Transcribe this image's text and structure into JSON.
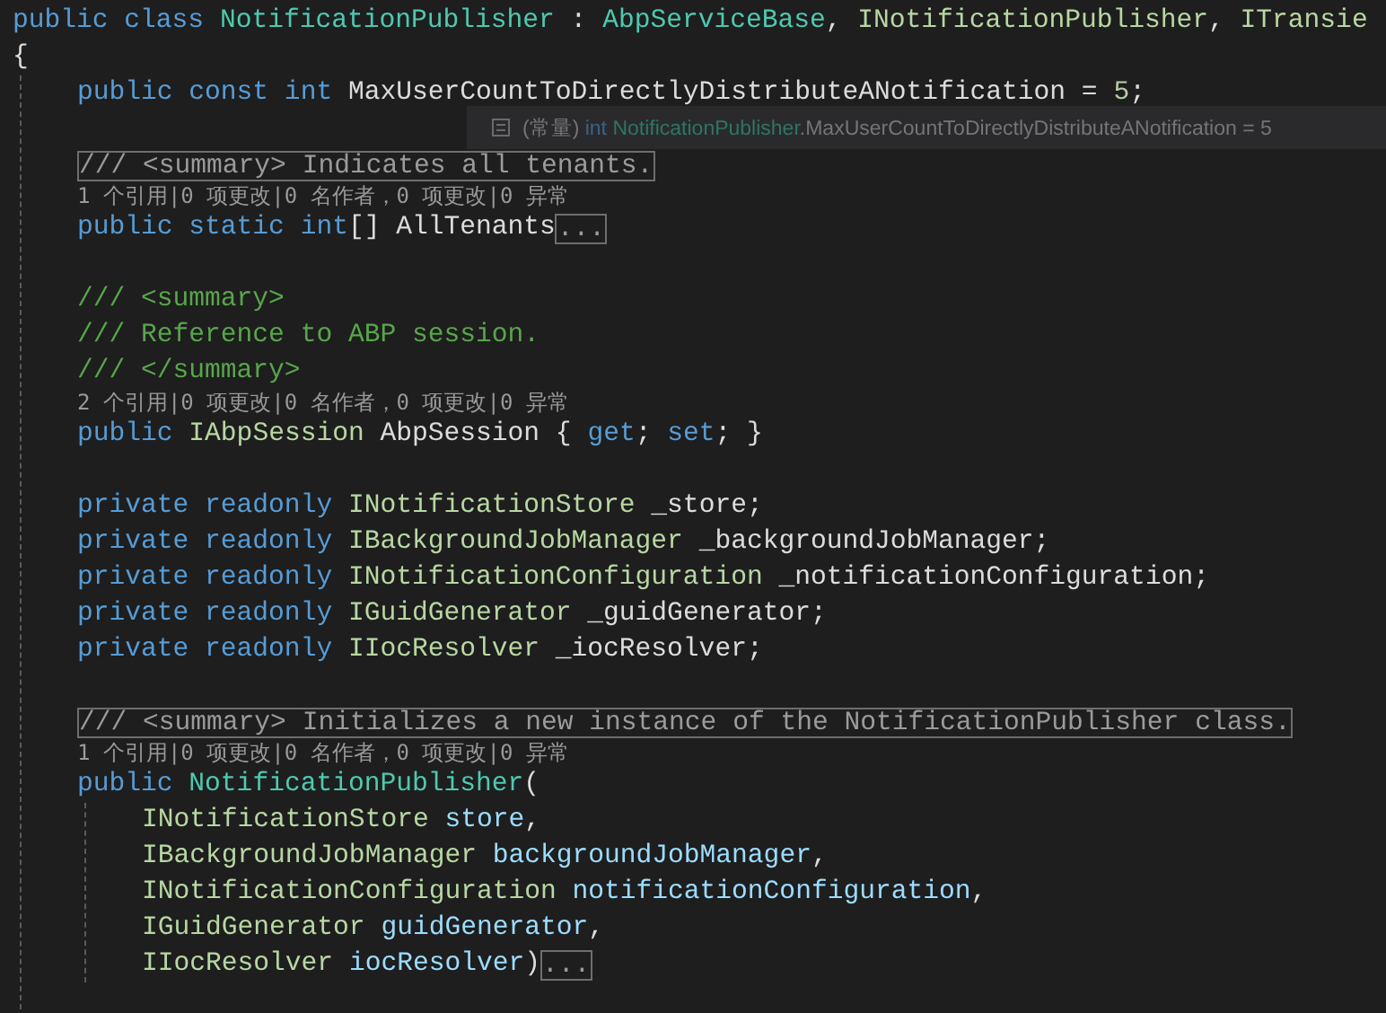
{
  "editor": {
    "lines": [
      {
        "kind": "code",
        "tokens": [
          {
            "text": "public class ",
            "kind": "keyword"
          },
          {
            "text": "NotificationPublisher",
            "kind": "class"
          },
          {
            "text": " : ",
            "kind": "plain"
          },
          {
            "text": "AbpServiceBase",
            "kind": "class"
          },
          {
            "text": ", ",
            "kind": "plain"
          },
          {
            "text": "INotificationPublisher",
            "kind": "interface"
          },
          {
            "text": ", ",
            "kind": "plain"
          },
          {
            "text": "ITransie",
            "kind": "interface"
          }
        ]
      },
      {
        "kind": "code",
        "tokens": [
          {
            "text": "{",
            "kind": "plain"
          }
        ]
      },
      {
        "kind": "block",
        "children": [
          {
            "kind": "code",
            "tokens": [
              {
                "text": "public const int ",
                "kind": "keyword"
              },
              {
                "text": "MaxUserCountToDirectlyDistributeANotification = ",
                "kind": "plain"
              },
              {
                "text": "5",
                "kind": "number"
              },
              {
                "text": ";",
                "kind": "plain"
              }
            ]
          },
          {
            "kind": "blank"
          },
          {
            "kind": "code",
            "tokens": [
              {
                "text": "/// <summary> Indicates all tenants.",
                "kind": "collapsed"
              }
            ]
          },
          {
            "kind": "lens",
            "text": "1 个引用|0 项更改|0 名作者，0 项更改|0 异常"
          },
          {
            "kind": "code",
            "tokens": [
              {
                "text": "public static int",
                "kind": "keyword"
              },
              {
                "text": "[] AllTenants",
                "kind": "plain"
              },
              {
                "text": "...",
                "kind": "collapsed"
              }
            ]
          },
          {
            "kind": "blank"
          },
          {
            "kind": "code",
            "tokens": [
              {
                "text": "/// <summary>",
                "kind": "comment"
              }
            ]
          },
          {
            "kind": "code",
            "tokens": [
              {
                "text": "/// Reference to ABP session.",
                "kind": "comment"
              }
            ]
          },
          {
            "kind": "code",
            "tokens": [
              {
                "text": "/// </summary>",
                "kind": "comment"
              }
            ]
          },
          {
            "kind": "lens",
            "text": "2 个引用|0 项更改|0 名作者，0 项更改|0 异常"
          },
          {
            "kind": "code",
            "tokens": [
              {
                "text": "public ",
                "kind": "keyword"
              },
              {
                "text": "IAbpSession",
                "kind": "interface"
              },
              {
                "text": " AbpSession { ",
                "kind": "plain"
              },
              {
                "text": "get",
                "kind": "keyword"
              },
              {
                "text": "; ",
                "kind": "plain"
              },
              {
                "text": "set",
                "kind": "keyword"
              },
              {
                "text": "; }",
                "kind": "plain"
              }
            ]
          },
          {
            "kind": "blank"
          },
          {
            "kind": "code",
            "tokens": [
              {
                "text": "private readonly ",
                "kind": "keyword"
              },
              {
                "text": "INotificationStore",
                "kind": "interface"
              },
              {
                "text": " _store;",
                "kind": "plain"
              }
            ]
          },
          {
            "kind": "code",
            "tokens": [
              {
                "text": "private readonly ",
                "kind": "keyword"
              },
              {
                "text": "IBackgroundJobManager",
                "kind": "interface"
              },
              {
                "text": " _backgroundJobManager;",
                "kind": "plain"
              }
            ]
          },
          {
            "kind": "code",
            "tokens": [
              {
                "text": "private readonly ",
                "kind": "keyword"
              },
              {
                "text": "INotificationConfiguration",
                "kind": "interface"
              },
              {
                "text": " _notificationConfiguration;",
                "kind": "plain"
              }
            ]
          },
          {
            "kind": "code",
            "tokens": [
              {
                "text": "private readonly ",
                "kind": "keyword"
              },
              {
                "text": "IGuidGenerator",
                "kind": "interface"
              },
              {
                "text": " _guidGenerator;",
                "kind": "plain"
              }
            ]
          },
          {
            "kind": "code",
            "tokens": [
              {
                "text": "private readonly ",
                "kind": "keyword"
              },
              {
                "text": "IIocResolver",
                "kind": "interface"
              },
              {
                "text": " _iocResolver;",
                "kind": "plain"
              }
            ]
          },
          {
            "kind": "blank"
          },
          {
            "kind": "code",
            "tokens": [
              {
                "text": "/// <summary> Initializes a new instance of the NotificationPublisher class.",
                "kind": "collapsed"
              }
            ]
          },
          {
            "kind": "lens",
            "text": "1 个引用|0 项更改|0 名作者，0 项更改|0 异常"
          },
          {
            "kind": "code",
            "tokens": [
              {
                "text": "public ",
                "kind": "keyword"
              },
              {
                "text": "NotificationPublisher",
                "kind": "class"
              },
              {
                "text": "(",
                "kind": "plain"
              }
            ]
          },
          {
            "kind": "block",
            "children": [
              {
                "kind": "code",
                "tokens": [
                  {
                    "text": "INotificationStore ",
                    "kind": "interface"
                  },
                  {
                    "text": "store",
                    "kind": "param"
                  },
                  {
                    "text": ",",
                    "kind": "plain"
                  }
                ]
              },
              {
                "kind": "code",
                "tokens": [
                  {
                    "text": "IBackgroundJobManager ",
                    "kind": "interface"
                  },
                  {
                    "text": "backgroundJobManager",
                    "kind": "param"
                  },
                  {
                    "text": ",",
                    "kind": "plain"
                  }
                ]
              },
              {
                "kind": "code",
                "tokens": [
                  {
                    "text": "INotificationConfiguration ",
                    "kind": "interface"
                  },
                  {
                    "text": "notificationConfiguration",
                    "kind": "param"
                  },
                  {
                    "text": ",",
                    "kind": "plain"
                  }
                ]
              },
              {
                "kind": "code",
                "tokens": [
                  {
                    "text": "IGuidGenerator ",
                    "kind": "interface"
                  },
                  {
                    "text": "guidGenerator",
                    "kind": "param"
                  },
                  {
                    "text": ",",
                    "kind": "plain"
                  }
                ]
              },
              {
                "kind": "code",
                "tokens": [
                  {
                    "text": "IIocResolver ",
                    "kind": "interface"
                  },
                  {
                    "text": "iocResolver",
                    "kind": "param"
                  },
                  {
                    "text": ")",
                    "kind": "plain"
                  },
                  {
                    "text": "...",
                    "kind": "collapsed"
                  }
                ]
              }
            ]
          },
          {
            "kind": "blank"
          }
        ]
      }
    ]
  },
  "quick_info": {
    "tokens": [
      {
        "text": "(常量) ",
        "kind": "plain"
      },
      {
        "text": "int ",
        "kind": "keyword"
      },
      {
        "text": "NotificationPublisher",
        "kind": "class"
      },
      {
        "text": ".MaxUserCountToDirectlyDistributeANotification = 5",
        "kind": "plain"
      }
    ]
  }
}
